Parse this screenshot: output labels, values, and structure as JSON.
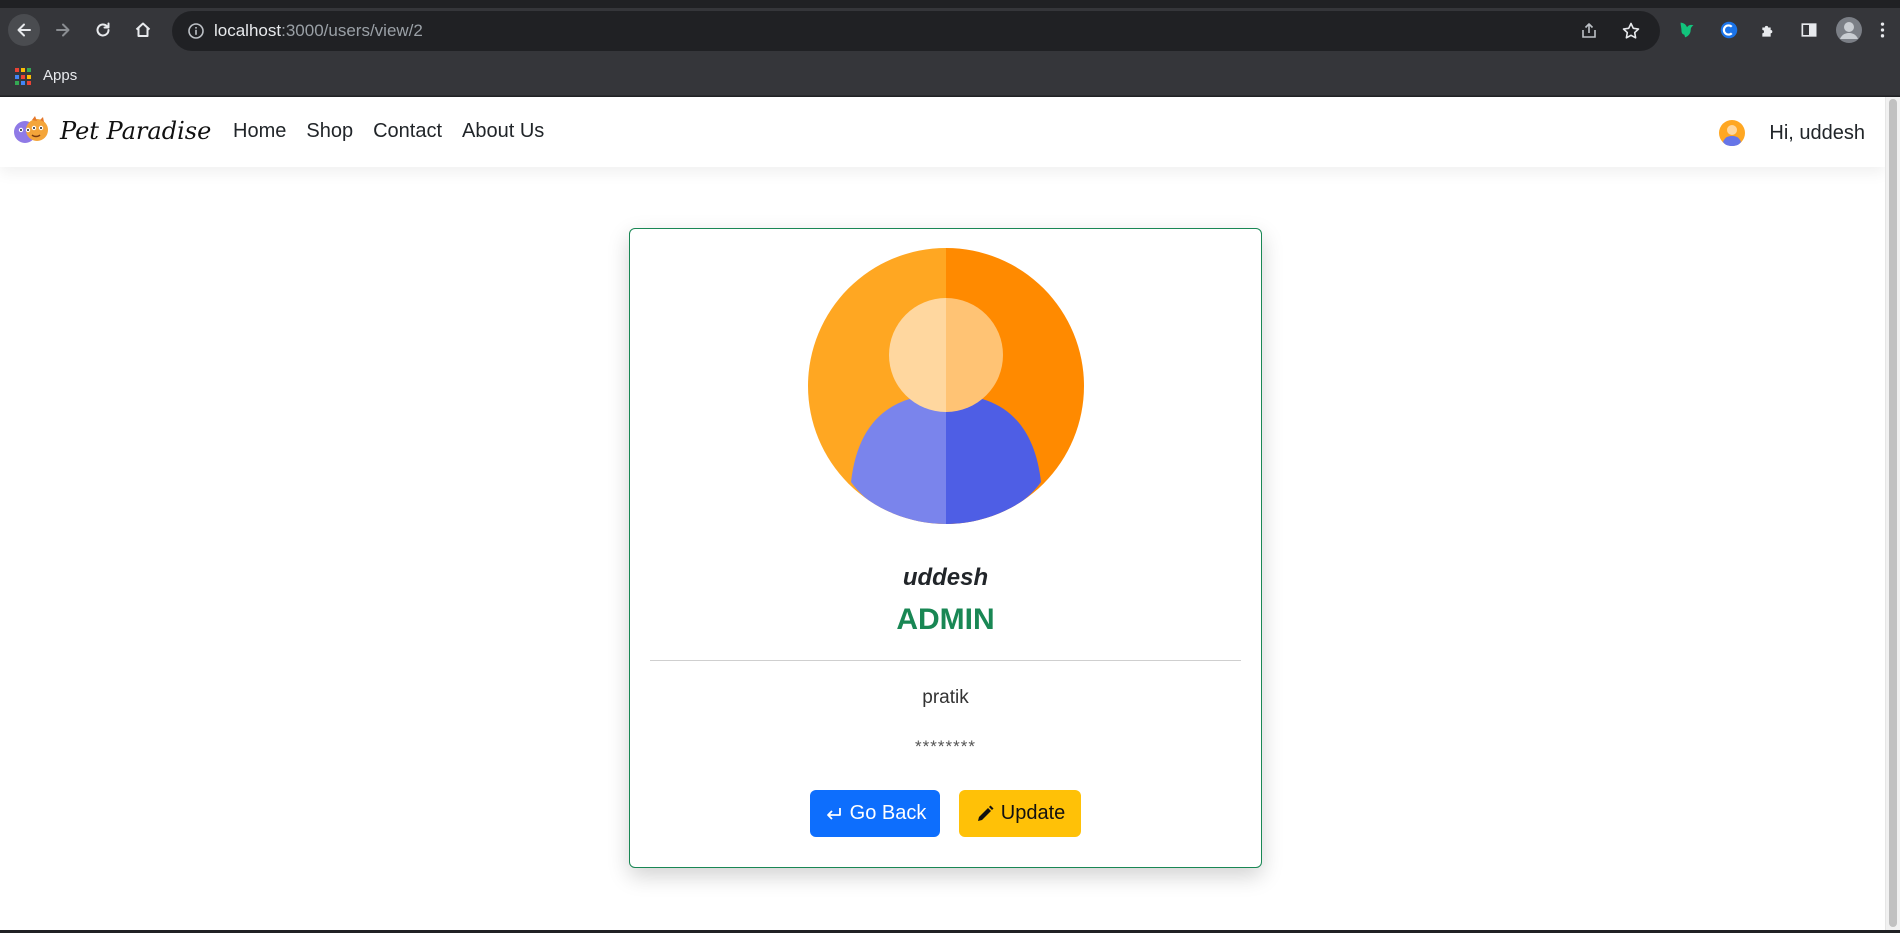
{
  "browser": {
    "url_host": "localhost",
    "url_path": ":3000/users/view/2",
    "bookmarks": {
      "apps_label": "Apps"
    },
    "icons": [
      "back-icon",
      "forward-icon",
      "reload-icon",
      "home-icon",
      "info-icon",
      "share-icon",
      "star-icon",
      "extension-icon",
      "sidepanel-icon",
      "profile-icon",
      "menu-icon"
    ]
  },
  "navbar": {
    "brand": "Pet Paradise",
    "links": [
      "Home",
      "Shop",
      "Contact",
      "About Us"
    ],
    "greeting": "Hi, uddesh"
  },
  "profile": {
    "name": "uddesh",
    "role": "ADMIN",
    "username": "pratik",
    "password_masked": "********",
    "back_label": "Go Back",
    "update_label": "Update"
  },
  "colors": {
    "primary": "#0d6efd",
    "warning": "#ffc107",
    "success": "#198754",
    "avatar_orange": "#ffa722",
    "avatar_orange_dark": "#ff8a00",
    "avatar_blue": "#7a84ec",
    "avatar_blue_dark": "#4e5ee5"
  }
}
